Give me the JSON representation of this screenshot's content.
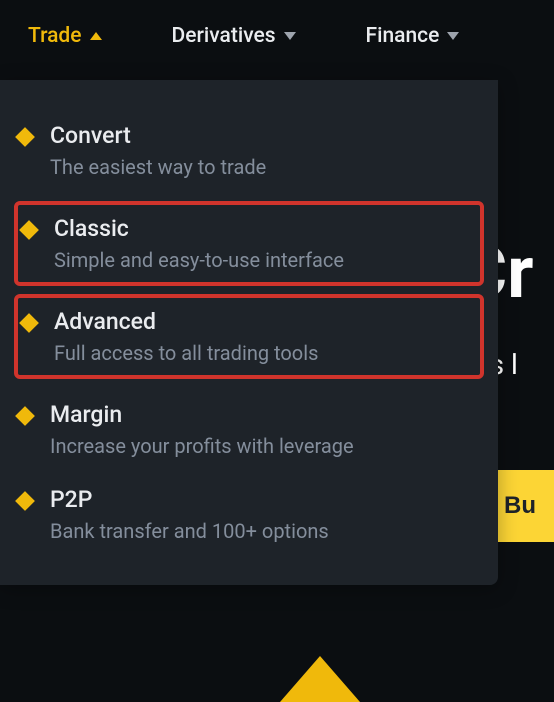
{
  "nav": {
    "trade": "Trade",
    "derivatives": "Derivatives",
    "finance": "Finance"
  },
  "dropdown": {
    "items": [
      {
        "title": "Convert",
        "desc": "The easiest way to trade",
        "highlighted": false
      },
      {
        "title": "Classic",
        "desc": "Simple and easy-to-use interface",
        "highlighted": true
      },
      {
        "title": "Advanced",
        "desc": "Full access to all trading tools",
        "highlighted": true
      },
      {
        "title": "Margin",
        "desc": "Increase your profits with leverage",
        "highlighted": false
      },
      {
        "title": "P2P",
        "desc": "Bank transfer and 100+ options",
        "highlighted": false
      }
    ]
  },
  "background": {
    "heading_fragment": "Cr",
    "sub_fragment": "d's l",
    "button_fragment": "Bu"
  }
}
